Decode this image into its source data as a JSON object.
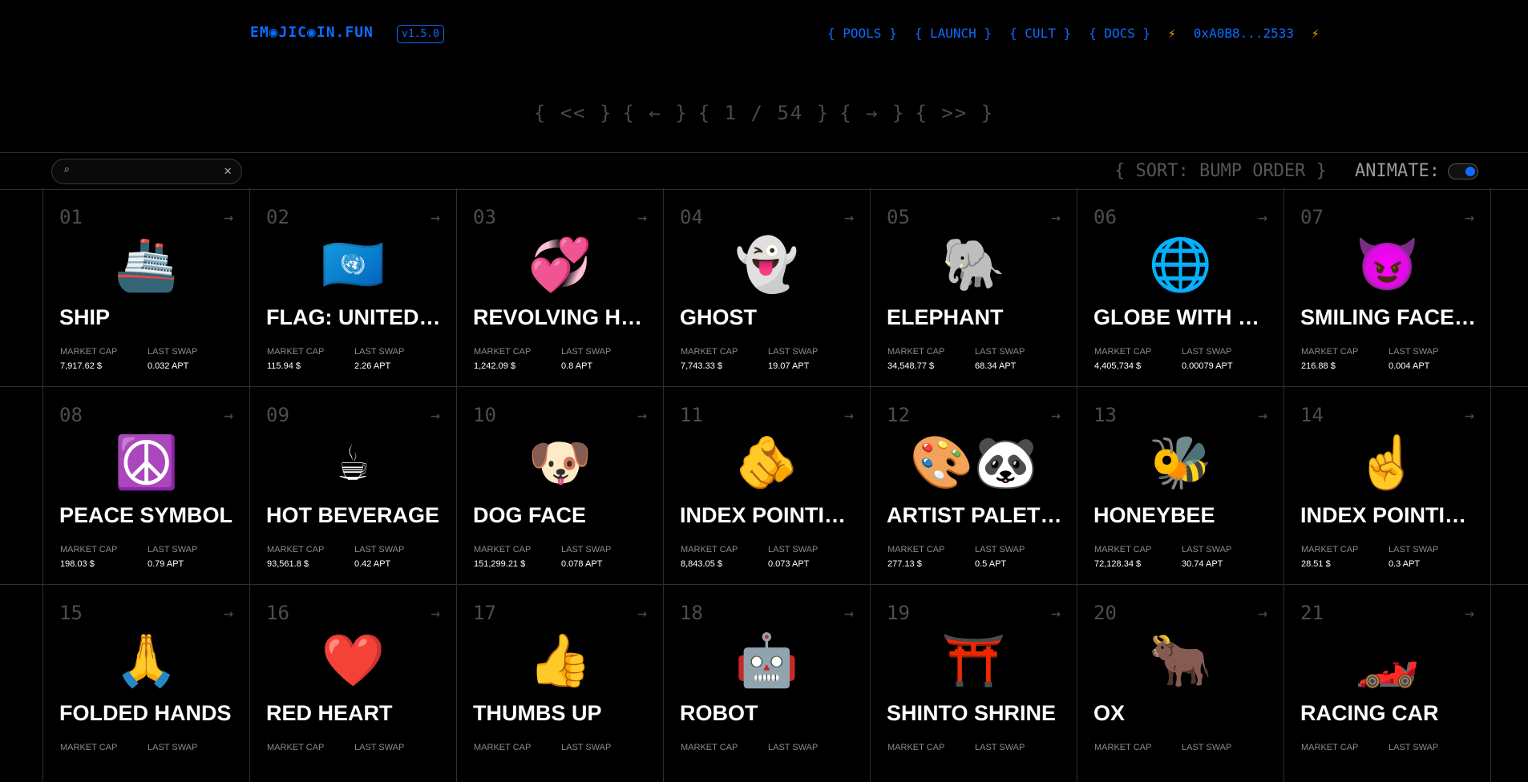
{
  "header": {
    "logo": "EM◉JIC◉IN.FUN",
    "version": "v1.5.0",
    "nav": [
      {
        "label": "{ POOLS }"
      },
      {
        "label": "{ LAUNCH }"
      },
      {
        "label": "{ CULT }"
      },
      {
        "label": "{ DOCS }"
      }
    ],
    "wallet": "0xA0B8...2533",
    "bolt_left": "⚡",
    "bolt_right": "⚡"
  },
  "pager": {
    "first": "{ << }",
    "prev": "{ ← }",
    "page": "{ 1 / 54 }",
    "next": "{ → }",
    "last": "{ >> }"
  },
  "toolbar": {
    "search_value": "",
    "sort_prefix": "{ SORT:",
    "sort_value": "BUMP ORDER",
    "sort_suffix": "}",
    "animate_label": "ANIMATE:",
    "animate_on": true
  },
  "card_labels": {
    "market_cap": "MARKET CAP",
    "last_swap": "LAST SWAP"
  },
  "cards": [
    {
      "num": "01",
      "emoji": "🚢",
      "name": "SHIP",
      "market_cap": "7,917.62 $",
      "last_swap": "0.032 APT"
    },
    {
      "num": "02",
      "emoji": "🇺🇳",
      "name": "FLAG: UNITED NATIONS",
      "market_cap": "115.94 $",
      "last_swap": "2.26 APT"
    },
    {
      "num": "03",
      "emoji": "💞",
      "name": "REVOLVING HEARTS",
      "market_cap": "1,242.09 $",
      "last_swap": "0.8 APT"
    },
    {
      "num": "04",
      "emoji": "👻",
      "name": "GHOST",
      "market_cap": "7,743.33 $",
      "last_swap": "19.07 APT"
    },
    {
      "num": "05",
      "emoji": "🐘",
      "name": "ELEPHANT",
      "market_cap": "34,548.77 $",
      "last_swap": "68.34 APT"
    },
    {
      "num": "06",
      "emoji": "🌐",
      "name": "GLOBE WITH MERIDIANS",
      "market_cap": "4,405,734 $",
      "last_swap": "0.00079 APT"
    },
    {
      "num": "07",
      "emoji": "😈",
      "name": "SMILING FACE WITH HORNS",
      "market_cap": "216.88 $",
      "last_swap": "0.004 APT"
    },
    {
      "num": "08",
      "emoji": "☮️",
      "name": "PEACE SYMBOL",
      "market_cap": "198.03 $",
      "last_swap": "0.79 APT"
    },
    {
      "num": "09",
      "emoji": "☕",
      "name": "HOT BEVERAGE",
      "market_cap": "93,561.8 $",
      "last_swap": "0.42 APT"
    },
    {
      "num": "10",
      "emoji": "🐶",
      "name": "DOG FACE",
      "market_cap": "151,299.21 $",
      "last_swap": "0.078 APT"
    },
    {
      "num": "11",
      "emoji": "🫵",
      "name": "INDEX POINTING AT THE VIEWER",
      "market_cap": "8,843.05 $",
      "last_swap": "0.073 APT"
    },
    {
      "num": "12",
      "emoji": "🎨🐼",
      "name": "ARTIST PALETTE PANDA",
      "market_cap": "277.13 $",
      "last_swap": "0.5 APT"
    },
    {
      "num": "13",
      "emoji": "🐝",
      "name": "HONEYBEE",
      "market_cap": "72,128.34 $",
      "last_swap": "30.74 APT"
    },
    {
      "num": "14",
      "emoji": "☝️",
      "name": "INDEX POINTING UP",
      "market_cap": "28.51 $",
      "last_swap": "0.3 APT"
    },
    {
      "num": "15",
      "emoji": "🙏",
      "name": "FOLDED HANDS",
      "market_cap": "",
      "last_swap": ""
    },
    {
      "num": "16",
      "emoji": "❤️",
      "name": "RED HEART",
      "market_cap": "",
      "last_swap": ""
    },
    {
      "num": "17",
      "emoji": "👍",
      "name": "THUMBS UP",
      "market_cap": "",
      "last_swap": ""
    },
    {
      "num": "18",
      "emoji": "🤖",
      "name": "ROBOT",
      "market_cap": "",
      "last_swap": ""
    },
    {
      "num": "19",
      "emoji": "⛩️",
      "name": "SHINTO SHRINE",
      "market_cap": "",
      "last_swap": ""
    },
    {
      "num": "20",
      "emoji": "🐂",
      "name": "OX",
      "market_cap": "",
      "last_swap": ""
    },
    {
      "num": "21",
      "emoji": "🏎️",
      "name": "RACING CAR",
      "market_cap": "",
      "last_swap": ""
    }
  ],
  "colors": {
    "accent": "#0b6cff",
    "bolt": "#e6b800",
    "background": "#000000",
    "muted": "#4d4d4d"
  },
  "icons": {
    "search": "search-icon",
    "clear": "close-icon",
    "card_action": "arrow-right-icon"
  }
}
